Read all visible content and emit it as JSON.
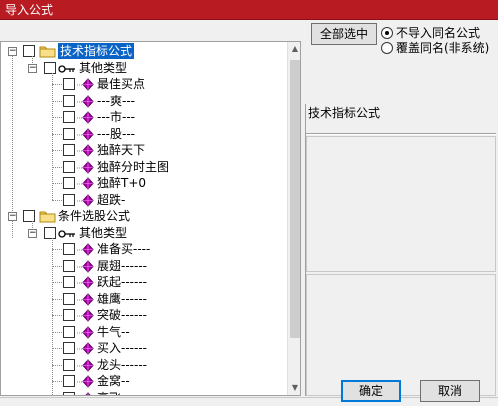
{
  "window": {
    "title": "导入公式"
  },
  "tree": {
    "root1": {
      "label": "技术指标公式"
    },
    "group1": {
      "label": "其他类型"
    },
    "items1": [
      {
        "label": "最佳买点"
      },
      {
        "label": "---爽---"
      },
      {
        "label": "---市---"
      },
      {
        "label": "---股---"
      },
      {
        "label": "独醉天下"
      },
      {
        "label": "独醉分时主图"
      },
      {
        "label": "独醉T+0"
      },
      {
        "label": "超跌-"
      }
    ],
    "root2": {
      "label": "条件选股公式"
    },
    "group2": {
      "label": "其他类型"
    },
    "items2": [
      {
        "label": "准备买----"
      },
      {
        "label": "展翅------"
      },
      {
        "label": "跃起------"
      },
      {
        "label": "雄鹰------"
      },
      {
        "label": "突破------"
      },
      {
        "label": "牛气--"
      },
      {
        "label": "买入------"
      },
      {
        "label": "龙头------"
      },
      {
        "label": "金窝--"
      },
      {
        "label": "高飞------"
      }
    ]
  },
  "buttons": {
    "select_all": "全部选中",
    "ok": "确定",
    "cancel": "取消"
  },
  "options": {
    "no_import_same": "不导入同名公式",
    "overwrite_same": "覆盖同名(非系统)",
    "selected": "no_import_same"
  },
  "info": {
    "category": "技术指标公式"
  },
  "colors": {
    "title_bar": "#b81c22",
    "selection": "#0a64c8",
    "gem": "#b400b4"
  }
}
